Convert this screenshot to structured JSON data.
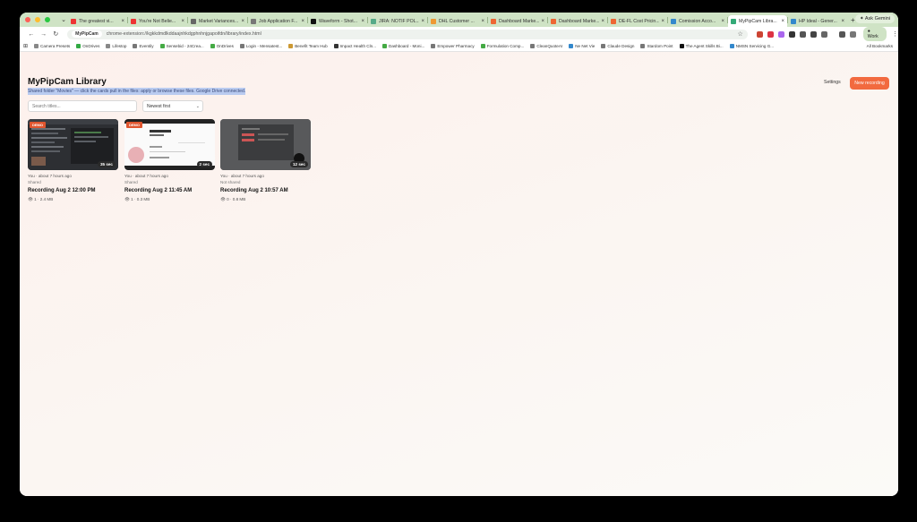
{
  "browser": {
    "tabs": [
      {
        "label": "The greatest vi...",
        "color": "#e33"
      },
      {
        "label": "You're Not Belie...",
        "color": "#e33"
      },
      {
        "label": "Market Variances...",
        "color": "#666"
      },
      {
        "label": "Job Application F...",
        "color": "#777"
      },
      {
        "label": "Waveform - Shot...",
        "color": "#111"
      },
      {
        "label": "JIRA: NOTIF POL...",
        "color": "#5a8"
      },
      {
        "label": "DHL Customer ...",
        "color": "#e93"
      },
      {
        "label": "Dashboard Marke...",
        "color": "#e63"
      },
      {
        "label": "Dashboard Marke...",
        "color": "#e63"
      },
      {
        "label": "DE-FL Cost Pricin...",
        "color": "#e63"
      },
      {
        "label": "Comission Acco...",
        "color": "#38c"
      },
      {
        "label": "MyPipCam Libra...",
        "color": "#3a7"
      },
      {
        "label": "HP Ideal - Gener...",
        "color": "#38c"
      }
    ],
    "active_tab_index": 11,
    "ask_gemini_label": "Ask Gemini",
    "site_chip": "MyPipCam",
    "url": "chrome-extension://kgkkdmdlkddaajnhkdgphnhnjgapoifdn/library/index.html",
    "profile_label": "Work",
    "bookmarks": [
      {
        "label": "Camera Presets",
        "color": "#888"
      },
      {
        "label": "OnDrives",
        "color": "#3a4"
      },
      {
        "label": "Lifestop",
        "color": "#888"
      },
      {
        "label": "Eventily",
        "color": "#777"
      },
      {
        "label": "Sensebid - 24Crea...",
        "color": "#4a4"
      },
      {
        "label": "OnDrives",
        "color": "#4a4"
      },
      {
        "label": "Login - Mensatest...",
        "color": "#777"
      },
      {
        "label": "Benefit Team Hub",
        "color": "#c93"
      },
      {
        "label": "Impact Health Cln...",
        "color": "#333"
      },
      {
        "label": "Dashboard - Moni...",
        "color": "#4a4"
      },
      {
        "label": "Empower Pharmacy",
        "color": "#777"
      },
      {
        "label": "Formulation Comp...",
        "color": "#4a4"
      },
      {
        "label": "CleanQuoteAI",
        "color": "#777"
      },
      {
        "label": "Ne Net Vie",
        "color": "#38c"
      },
      {
        "label": "Claude Design",
        "color": "#777"
      },
      {
        "label": "Stardom Point",
        "color": "#777"
      },
      {
        "label": "The Agent Skills Bi...",
        "color": "#111"
      },
      {
        "label": "NMSN Servicing G...",
        "color": "#38c"
      }
    ],
    "all_bookmarks_label": "All Bookmarks"
  },
  "page": {
    "title": "MyPipCam Library",
    "subtitle": "Shared folder \"Movies\" — click the cards pull in the files: apply or browse these files. Google Drive connected.",
    "settings_label": "Settings",
    "new_recording_label": "New recording",
    "search_placeholder": "Search titles...",
    "sort_value": "Newest first"
  },
  "recordings": [
    {
      "badge": "DEMO",
      "duration": "35 sec",
      "meta": "You · about 7 hours ago",
      "shared": "Shared",
      "title": "Recording Aug 2 12:00 PM",
      "stats": "1 · 2.4 MB"
    },
    {
      "badge": "DEMO",
      "duration": "2 sec",
      "meta": "You · about 7 hours ago",
      "shared": "Shared",
      "title": "Recording Aug 2 11:45 AM",
      "stats": "1 · 0.3 MB"
    },
    {
      "badge": "",
      "duration": "12 sec",
      "meta": "You · about 7 hours ago",
      "shared": "Not shared",
      "title": "Recording Aug 2 10:57 AM",
      "stats": "0 · 0.8 MB"
    }
  ],
  "colors": {
    "accent": "#f26a3f",
    "badge": "#e0552e",
    "tabstrip": "#cfe3c5"
  }
}
